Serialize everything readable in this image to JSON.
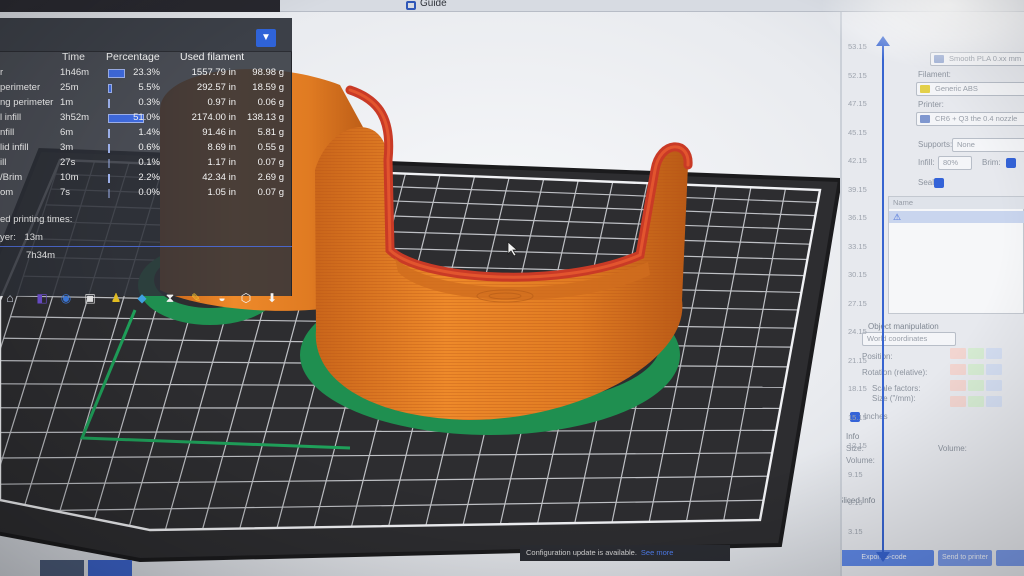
{
  "app": {
    "menu": {
      "guide_label": "Guide"
    }
  },
  "legend": {
    "columns": {
      "time": "Time",
      "percentage": "Percentage",
      "used_filament": "Used filament"
    },
    "rows": [
      {
        "name": "r",
        "time": "1h46m",
        "bar": 0.46,
        "pct": "23.3%",
        "len": "1557.79 in",
        "g": "98.98 g"
      },
      {
        "name": "perimeter",
        "time": "25m",
        "bar": 0.11,
        "pct": "5.5%",
        "len": "292.57 in",
        "g": "18.59 g"
      },
      {
        "name": "ng perimeter",
        "time": "1m",
        "bar": 0.01,
        "pct": "0.3%",
        "len": "0.97 in",
        "g": "0.06 g"
      },
      {
        "name": "l infill",
        "time": "3h52m",
        "bar": 1.0,
        "pct": "51.0%",
        "len": "2174.00 in",
        "g": "138.13 g"
      },
      {
        "name": "nfill",
        "time": "6m",
        "bar": 0.03,
        "pct": "1.4%",
        "len": "91.46 in",
        "g": "5.81 g"
      },
      {
        "name": "lid infill",
        "time": "3m",
        "bar": 0.01,
        "pct": "0.6%",
        "len": "8.69 in",
        "g": "0.55 g"
      },
      {
        "name": "ill",
        "time": "27s",
        "bar": 0.0,
        "pct": "0.1%",
        "len": "1.17 in",
        "g": "0.07 g"
      },
      {
        "name": "/Brim",
        "time": "10m",
        "bar": 0.04,
        "pct": "2.2%",
        "len": "42.34 in",
        "g": "2.69 g"
      },
      {
        "name": "om",
        "time": "7s",
        "bar": 0.0,
        "pct": "0.0%",
        "len": "1.05 in",
        "g": "0.07 g"
      }
    ],
    "times_title": "ed printing times:",
    "times": [
      {
        "label": "yer:",
        "value": "13m"
      },
      {
        "label": "",
        "value": "7h34m"
      }
    ]
  },
  "sidebar": {
    "slider_ticks": [
      "53.15",
      "52.15",
      "47.15",
      "45.15",
      "42.15",
      "39.15",
      "36.15",
      "33.15",
      "30.15",
      "27.15",
      "24.15",
      "21.15",
      "18.15",
      "15.15",
      "12.15",
      "9.15",
      "6.15",
      "3.15"
    ],
    "print_settings_value": "Smooth PLA 0.xx mm",
    "filament_label": "Filament:",
    "filament_value": "Generic ABS",
    "printer_label": "Printer:",
    "printer_value": "CR6 + Q3 the 0.4 nozzle",
    "supports_label": "Supports:",
    "supports_value": "None",
    "infill_label": "Infill:",
    "infill_value": "80%",
    "brim_label": "Brim:",
    "seal_label": "Seal:",
    "name_header": "Name",
    "object_manipulation": "Object manipulation",
    "coords_value": "World coordinates",
    "position_label": "Position:",
    "rotation_label": "Rotation (relative):",
    "scale_label": "Scale factors:",
    "size_label": "Size (\"/mm):",
    "inches_label": "Inches",
    "info_title": "Info",
    "size_info_label": "Size:",
    "volume_label": "Volume:",
    "volume_value": "Volume:",
    "sliced_info_title": "Sliced Info",
    "btn_export_gcode": "Export G-code",
    "btn_send_to_printer": "Send to printer"
  },
  "notification": {
    "text": "Configuration update is available.",
    "link": "See more"
  },
  "colors": {
    "accent": "#3463d8",
    "part_orange": "#e07b22",
    "part_red": "#c93a26",
    "brim_green": "#1f8f50",
    "bed_dark": "#2d2d30"
  }
}
